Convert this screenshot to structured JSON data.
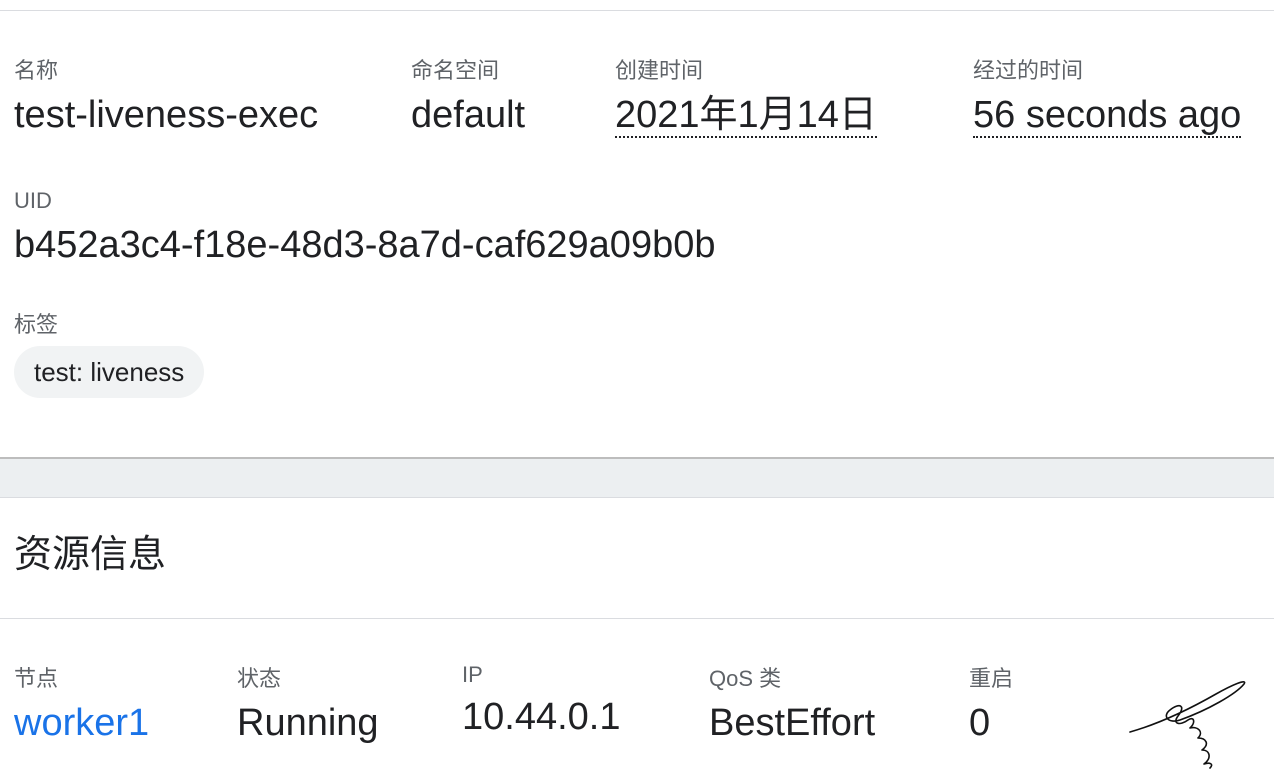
{
  "metadata": {
    "name": {
      "label": "名称",
      "value": "test-liveness-exec"
    },
    "namespace": {
      "label": "命名空间",
      "value": "default"
    },
    "created": {
      "label": "创建时间",
      "value": "2021年1月14日"
    },
    "age": {
      "label": "经过的时间",
      "value": "56 seconds ago"
    },
    "uid": {
      "label": "UID",
      "value": "b452a3c4-f18e-48d3-8a7d-caf629a09b0b"
    },
    "labels": {
      "label": "标签",
      "items": [
        "test: liveness"
      ]
    }
  },
  "resource": {
    "title": "资源信息",
    "node": {
      "label": "节点",
      "value": "worker1"
    },
    "status": {
      "label": "状态",
      "value": "Running"
    },
    "ip": {
      "label": "IP",
      "value": "10.44.0.1"
    },
    "qos": {
      "label": "QoS 类",
      "value": "BestEffort"
    },
    "restarts": {
      "label": "重启",
      "value": "0"
    }
  },
  "colors": {
    "link": "#1a73e8",
    "label": "#5f6368",
    "text": "#202124",
    "chip_bg": "#f1f3f4",
    "gap_bg": "#eceff1"
  }
}
